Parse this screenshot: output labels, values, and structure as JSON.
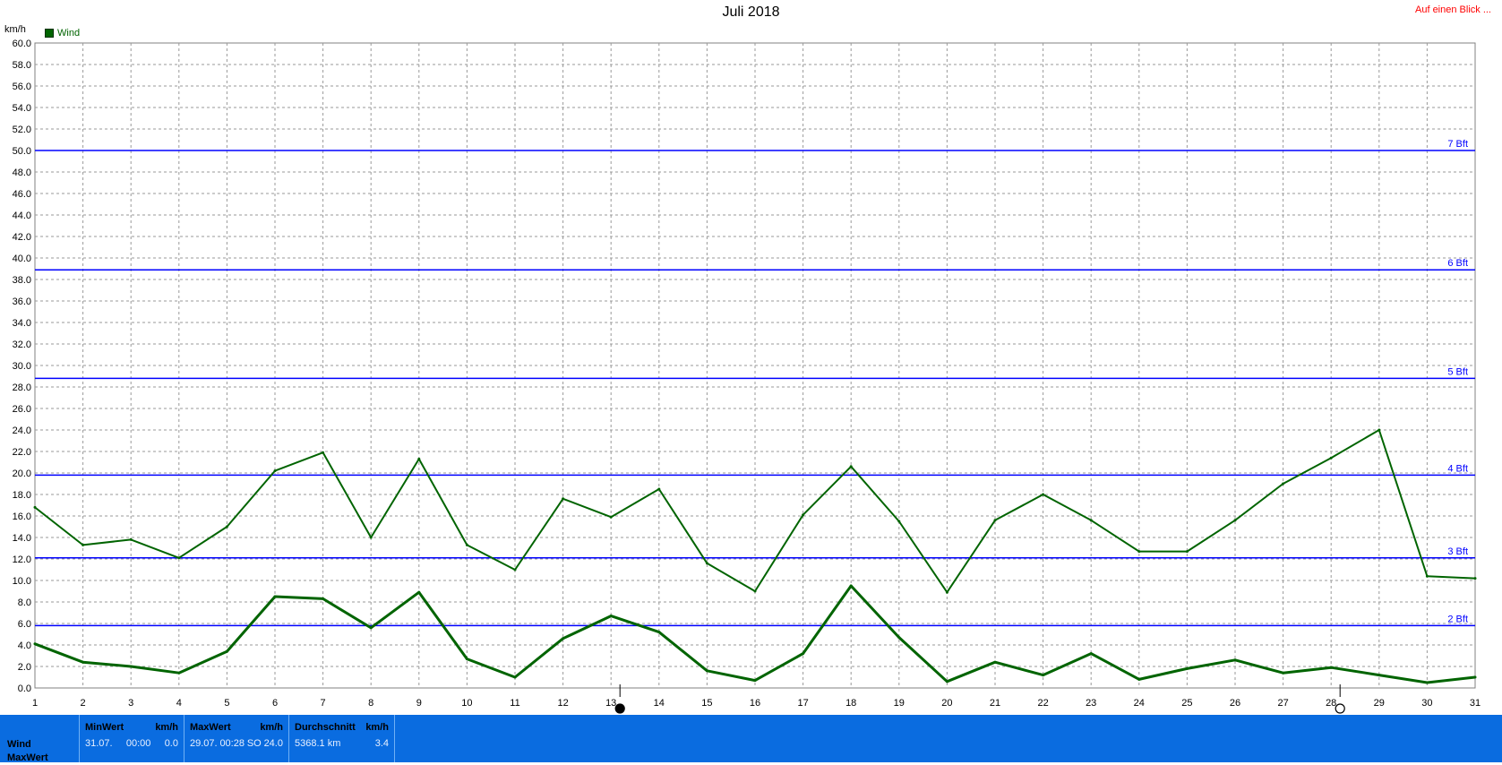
{
  "header": {
    "title": "Juli 2018",
    "link": "Auf einen Blick ...",
    "unit": "km/h",
    "legend_label": "Wind"
  },
  "colors": {
    "series": "#006400",
    "bft_line": "#0000ff",
    "link": "#ff0000",
    "stats_bg": "#0a6ce0"
  },
  "chart_data": {
    "type": "line",
    "title": "Juli 2018",
    "ylabel": "km/h",
    "ylim": [
      0,
      60
    ],
    "y_ticks": [
      "0.0",
      "2.0",
      "4.0",
      "6.0",
      "8.0",
      "10.0",
      "12.0",
      "14.0",
      "16.0",
      "18.0",
      "20.0",
      "22.0",
      "24.0",
      "26.0",
      "28.0",
      "30.0",
      "32.0",
      "34.0",
      "36.0",
      "38.0",
      "40.0",
      "42.0",
      "44.0",
      "46.0",
      "48.0",
      "50.0",
      "52.0",
      "54.0",
      "56.0",
      "58.0",
      "60.0"
    ],
    "x": [
      "1",
      "2",
      "3",
      "4",
      "5",
      "6",
      "7",
      "8",
      "9",
      "10",
      "11",
      "12",
      "13",
      "14",
      "15",
      "16",
      "17",
      "18",
      "19",
      "20",
      "21",
      "22",
      "23",
      "24",
      "25",
      "26",
      "27",
      "28",
      "29",
      "30",
      "31"
    ],
    "grid": true,
    "legend_position": "top-left",
    "legend": [
      "Wind"
    ],
    "series": [
      {
        "name": "Wind",
        "role": "max",
        "values": [
          16.8,
          13.3,
          13.8,
          12.1,
          15.0,
          20.2,
          21.9,
          14.0,
          21.3,
          13.3,
          11.0,
          17.6,
          15.9,
          18.5,
          11.6,
          9.0,
          16.1,
          20.6,
          15.5,
          8.9,
          15.6,
          18.0,
          15.6,
          12.7,
          12.7,
          15.6,
          19.0,
          21.4,
          24.0,
          10.4,
          10.2
        ]
      },
      {
        "name": "Wind",
        "role": "average",
        "values": [
          4.1,
          2.4,
          2.0,
          1.4,
          3.4,
          8.5,
          8.3,
          5.6,
          8.9,
          2.7,
          1.0,
          4.6,
          6.7,
          5.2,
          1.6,
          0.7,
          3.2,
          9.5,
          4.7,
          0.6,
          2.4,
          1.2,
          3.2,
          0.8,
          1.8,
          2.6,
          1.4,
          1.9,
          1.2,
          0.5,
          1.0
        ]
      }
    ],
    "beaufort_lines": [
      {
        "label": "2 Bft",
        "value": 5.8
      },
      {
        "label": "3 Bft",
        "value": 12.1
      },
      {
        "label": "4 Bft",
        "value": 19.8
      },
      {
        "label": "5 Bft",
        "value": 28.8
      },
      {
        "label": "6 Bft",
        "value": 38.9
      },
      {
        "label": "7 Bft",
        "value": 50.0
      }
    ],
    "moon_markers": [
      {
        "day": 13,
        "phase": "new-moon"
      },
      {
        "day": 28,
        "phase": "full-moon"
      }
    ]
  },
  "stats": {
    "row_labels": [
      "Wind",
      "MaxWert"
    ],
    "min": {
      "header": "MinWert",
      "unit": "km/h",
      "date": "31.07.",
      "time": "00:00",
      "value": "0.0"
    },
    "max": {
      "header": "MaxWert",
      "unit": "km/h",
      "date": "29.07.",
      "time": "00:28",
      "dir": "SO",
      "value": "24.0"
    },
    "avg": {
      "header": "Durchschnitt",
      "unit": "km/h",
      "distance": "5368.1 km",
      "value": "3.4"
    }
  }
}
